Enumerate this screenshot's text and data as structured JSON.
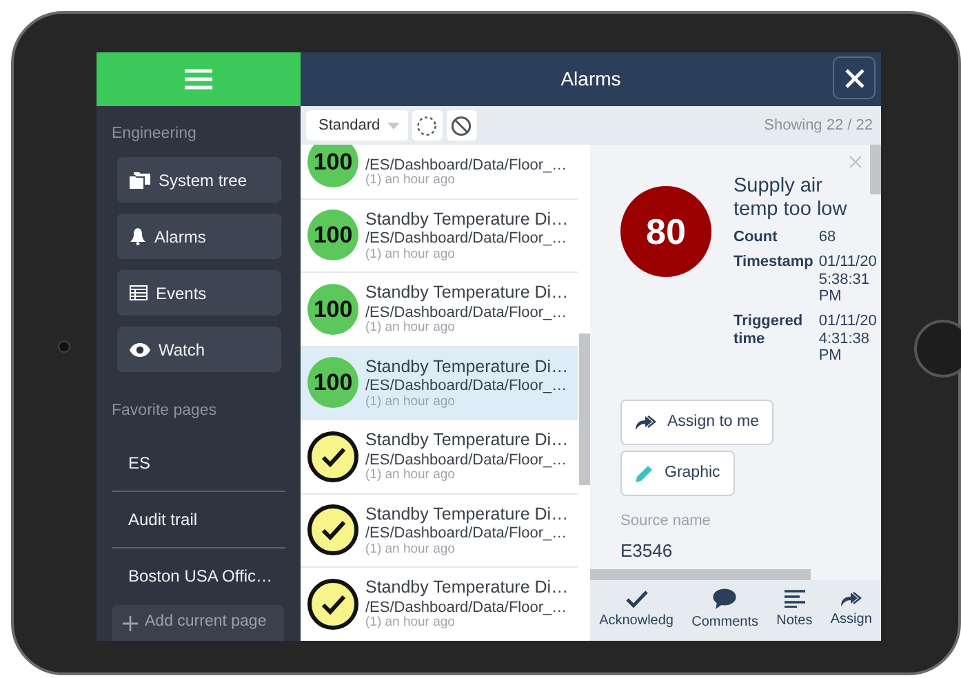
{
  "header": {
    "title": "Alarms"
  },
  "sidebar": {
    "sections": [
      {
        "heading": "Engineering",
        "kind": "buttons",
        "items": [
          {
            "label": "System tree"
          },
          {
            "label": "Alarms"
          },
          {
            "label": "Events"
          },
          {
            "label": "Watch"
          }
        ]
      },
      {
        "heading": "Favorite pages",
        "kind": "links",
        "items": [
          {
            "label": "ES"
          },
          {
            "label": "Audit trail"
          },
          {
            "label": "Boston USA Offic…"
          }
        ]
      }
    ],
    "add_button": "Add current page"
  },
  "toolbar": {
    "filter": "Standard",
    "showing": "Showing 22 / 22"
  },
  "alarms": [
    {
      "kind": "priority",
      "value": "100",
      "color": "#5cc85c",
      "path": "/ES/Dashboard/Data/Floor_…",
      "time": "(1) an hour ago",
      "selected": false
    },
    {
      "kind": "priority",
      "value": "100",
      "color": "#5cc85c",
      "title": "Standby Temperature Di…",
      "path": "/ES/Dashboard/Data/Floor_…",
      "time": "(1) an hour ago",
      "selected": false
    },
    {
      "kind": "priority",
      "value": "100",
      "color": "#5cc85c",
      "title": "Standby Temperature Di…",
      "path": "/ES/Dashboard/Data/Floor_…",
      "time": "(1) an hour ago",
      "selected": false
    },
    {
      "kind": "priority",
      "value": "100",
      "color": "#5cc85c",
      "title": "Standby Temperature Di…",
      "path": "/ES/Dashboard/Data/Floor_…",
      "time": "(1) an hour ago",
      "selected": true
    },
    {
      "kind": "acknowledged",
      "color": "#f7f48a",
      "title": "Standby Temperature Di…",
      "path": "/ES/Dashboard/Data/Floor_…",
      "time": "(1) an hour ago",
      "selected": false
    },
    {
      "kind": "acknowledged",
      "color": "#f7f48a",
      "title": "Standby Temperature Di…",
      "path": "/ES/Dashboard/Data/Floor_…",
      "time": "(1) an hour ago",
      "selected": false
    },
    {
      "kind": "acknowledged",
      "color": "#f7f48a",
      "title": "Standby Temperature Di…",
      "path": "/ES/Dashboard/Data/Floor_…",
      "time": "(1) an hour ago",
      "selected": false
    }
  ],
  "detail": {
    "priority": "80",
    "color": "#9b0000",
    "title": "Supply air temp too low",
    "fields": [
      {
        "label": "Count",
        "value": "68"
      },
      {
        "label": "Timestamp",
        "value": "01/11/20 5:38:31 PM"
      },
      {
        "label": "Triggered time",
        "value": "01/11/20 4:31:38 PM"
      }
    ],
    "buttons": [
      {
        "label": "Assign to me"
      },
      {
        "label": "Graphic"
      }
    ],
    "source_label": "Source name",
    "source_value": "E3546"
  },
  "actions": [
    {
      "label": "Acknowledg"
    },
    {
      "label": "Comments"
    },
    {
      "label": "Notes"
    },
    {
      "label": "Assign"
    }
  ]
}
